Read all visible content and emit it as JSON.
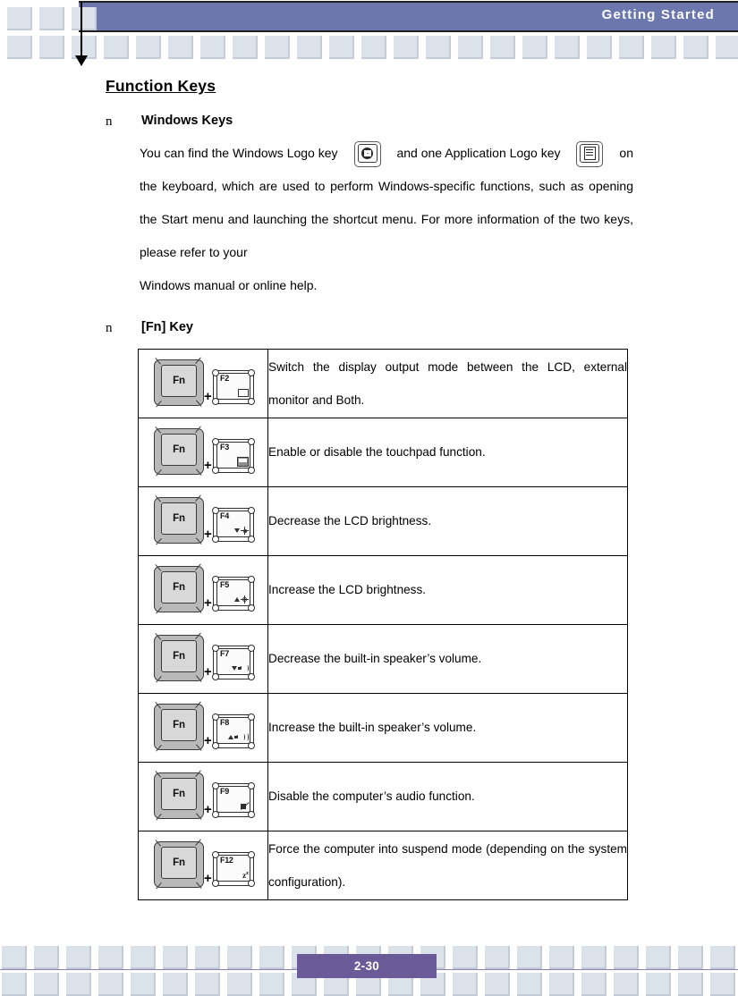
{
  "header": {
    "title": "Getting  Started"
  },
  "page": {
    "title": "Function Keys",
    "bullet_glyph": "n"
  },
  "sections": [
    {
      "label": "Windows Keys",
      "paragraph": {
        "part1": "You can find the Windows Logo key",
        "part2": "and one Application Logo key",
        "part3": "on  the  keyboard,  which  are  used  to  perform  Windows-specific functions,  such  as  opening  the  Start  menu  and  launching  the  shortcut menu.    For  more  information  of  the  two  keys,  please  refer  to  your",
        "part4": "Windows manual or online help.",
        "icon1": "windows-logo-key-icon",
        "icon2": "application-logo-key-icon"
      }
    },
    {
      "label": "[Fn] Key"
    }
  ],
  "fn_table": {
    "rows": [
      {
        "modifier": "Fn",
        "key": "F2",
        "key_icon": "monitor-icon",
        "description": "Switch  the  display  output  mode  between  the  LCD, external monitor and Both.",
        "two_line": true
      },
      {
        "modifier": "Fn",
        "key": "F3",
        "key_icon": "touchpad-icon",
        "description": "Enable or disable the touchpad function.",
        "two_line": false
      },
      {
        "modifier": "Fn",
        "key": "F4",
        "key_icon": "brightness-down-icon",
        "description": "Decrease the LCD brightness.",
        "two_line": false
      },
      {
        "modifier": "Fn",
        "key": "F5",
        "key_icon": "brightness-up-icon",
        "description": "Increase the LCD brightness.",
        "two_line": false
      },
      {
        "modifier": "Fn",
        "key": "F7",
        "key_icon": "volume-down-icon",
        "description": "Decrease the built-in speaker’s volume.",
        "two_line": false
      },
      {
        "modifier": "Fn",
        "key": "F8",
        "key_icon": "volume-up-icon",
        "description": "Increase the built-in speaker’s volume.",
        "two_line": false
      },
      {
        "modifier": "Fn",
        "key": "F9",
        "key_icon": "mute-icon",
        "description": "Disable the computer’s audio function.",
        "two_line": false
      },
      {
        "modifier": "Fn",
        "key": "F12",
        "key_icon": "sleep-icon",
        "description": "Force    the    computer    into    suspend    mode (depending on the system configuration).",
        "two_line": true
      }
    ],
    "plus_sign": "+"
  },
  "footer": {
    "page_number": "2-30"
  },
  "colors": {
    "header_band": "#6b77ad",
    "footer_badge": "#6a5a97",
    "decor_square": "#dbe2ea",
    "footer_rule": "#8f7fb5"
  }
}
